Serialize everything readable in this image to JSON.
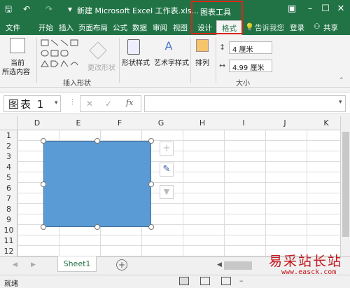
{
  "titlebar": {
    "title": "新建 Microsoft Excel 工作表.xls...",
    "context_title": "图表工具"
  },
  "tabs": [
    "文件",
    "开始",
    "插入",
    "页面布局",
    "公式",
    "数据",
    "审阅",
    "视图",
    "设计",
    "格式"
  ],
  "tell_me": "告诉我您",
  "signin": "登录",
  "share": "共享",
  "ribbon": {
    "current_selection": "当前\n所选内容",
    "current_selection_l1": "当前",
    "current_selection_l2": "所选内容",
    "change_shape": "更改形状",
    "insert_shapes_group": "插入形状",
    "shape_styles": "形状样式",
    "wordart_styles": "艺术字样式",
    "arrange": "排列",
    "height": "4 厘米",
    "width": "4.99 厘米",
    "size_group": "大小"
  },
  "formula_bar": {
    "name_box": "图表 1",
    "fx": "fx"
  },
  "columns": [
    "D",
    "E",
    "F",
    "G",
    "H",
    "I",
    "J",
    "K"
  ],
  "rows": [
    "1",
    "2",
    "3",
    "4",
    "5",
    "6",
    "7",
    "8",
    "9",
    "10",
    "11",
    "12"
  ],
  "sheet": {
    "tab": "Sheet1"
  },
  "status": {
    "text": "就绪"
  },
  "watermark": {
    "brand": "易采站长站",
    "url": "www.easck.com"
  },
  "colors": {
    "accent": "#217346",
    "chart_fill": "#5b9bd5",
    "highlight": "#d9271b"
  },
  "icons": [
    "save-icon",
    "undo-icon",
    "redo-icon",
    "plus-icon",
    "brush-icon",
    "filter-icon",
    "add-sheet-icon",
    "lightbulb-icon",
    "person-icon"
  ]
}
